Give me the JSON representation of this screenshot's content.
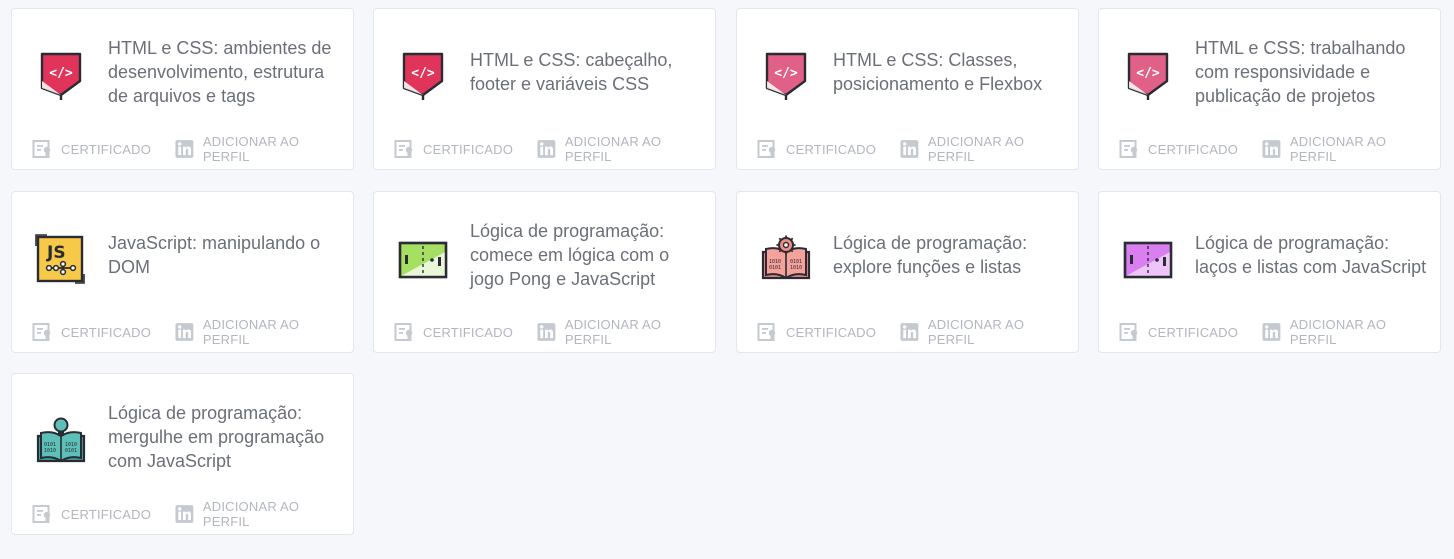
{
  "actions": {
    "certificate_label": "CERTIFICADO",
    "profile_label": "ADICIONAR AO PERFIL"
  },
  "colors": {
    "html_red": "#e0345a",
    "html_pink": "#e06087",
    "js_yellow": "#f7c948",
    "pong_green": "#a5e063",
    "pong_purple": "#d97ff0",
    "book_salmon": "#f08c84",
    "book_teal": "#3aa8a0",
    "muted_gray": "#b2b6be",
    "title_gray": "#6b6f78"
  },
  "courses": [
    {
      "title": "HTML e CSS: ambientes de desenvolvimento, estrutura de arquivos e tags",
      "icon": "html-css-icon"
    },
    {
      "title": "HTML e CSS: cabeçalho, footer e variáveis CSS",
      "icon": "html-css-icon"
    },
    {
      "title": "HTML e CSS: Classes, posicionamento e Flexbox",
      "icon": "html-css-icon"
    },
    {
      "title": "HTML e CSS: trabalhando com responsividade e publicação de projetos",
      "icon": "html-css-icon"
    },
    {
      "title": "JavaScript: manipulando o DOM",
      "icon": "javascript-icon"
    },
    {
      "title": "Lógica de programação: comece em lógica com o jogo Pong e JavaScript",
      "icon": "pong-green-icon"
    },
    {
      "title": "Lógica de programação: explore funções e listas",
      "icon": "book-gear-icon"
    },
    {
      "title": "Lógica de programação: laços e listas com JavaScript",
      "icon": "pong-purple-icon"
    },
    {
      "title": "Lógica de programação: mergulhe em programação com JavaScript",
      "icon": "book-lightbulb-icon"
    }
  ]
}
